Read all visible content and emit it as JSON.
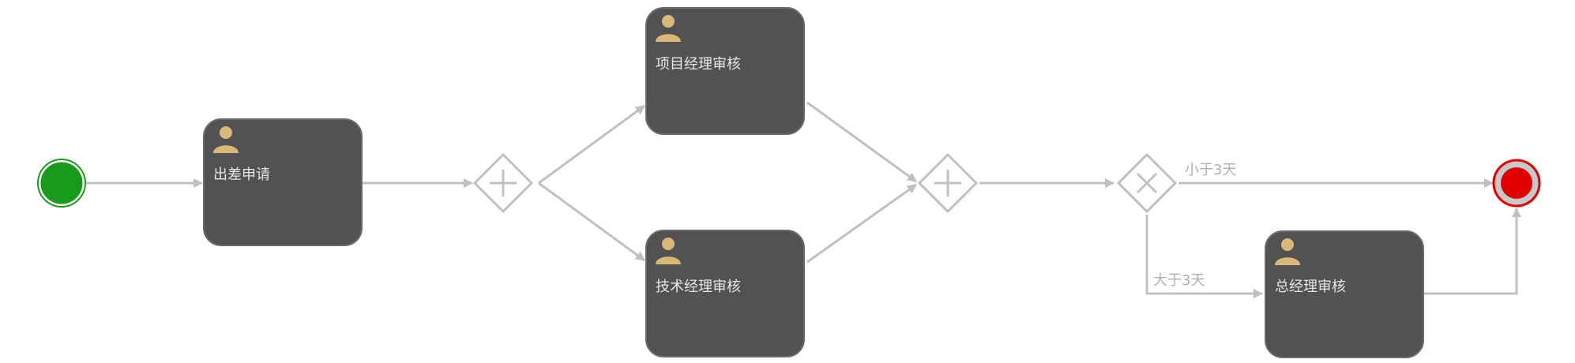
{
  "diagram": {
    "tasks": {
      "apply": {
        "label": "出差申请"
      },
      "pm_review": {
        "label": "项目经理审核"
      },
      "tech_review": {
        "label": "技术经理审核"
      },
      "gm_review": {
        "label": "总经理审核"
      }
    },
    "flows": {
      "less_than_3": {
        "label": "小于3天"
      },
      "more_than_3": {
        "label": "大于3天"
      }
    },
    "colors": {
      "task_fill": "#525252",
      "task_stroke": "#6a6a6a",
      "connector": "#c0c0c0",
      "start_event": "#1a9a1a",
      "end_event": "#e00000",
      "user_icon": "#d9b87a"
    },
    "icons": {
      "task": "user-icon",
      "parallel_gateway": "plus-icon",
      "exclusive_gateway": "x-icon"
    }
  }
}
